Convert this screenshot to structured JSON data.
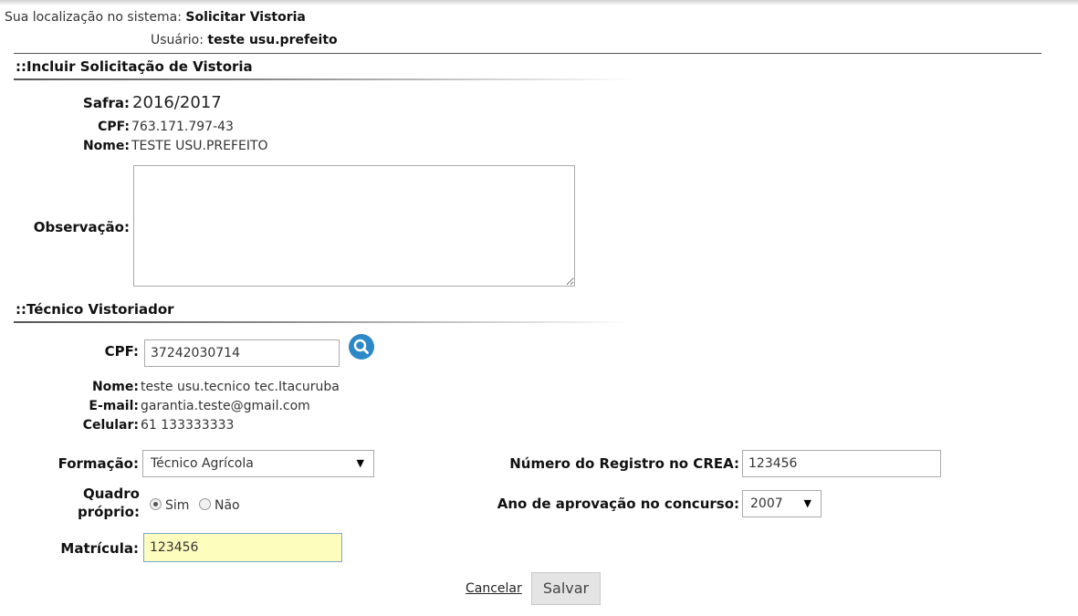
{
  "breadcrumb": {
    "prefix": "Sua localização no sistema:",
    "location": "Solicitar Vistoria"
  },
  "user": {
    "prefix": "Usuário:",
    "name": "teste usu.prefeito"
  },
  "section1": {
    "title": "::Incluir Solicitação de Vistoria",
    "safra_label": "Safra:",
    "safra_value": "2016/2017",
    "cpf_label": "CPF:",
    "cpf_value": "763.171.797-43",
    "nome_label": "Nome:",
    "nome_value": "TESTE USU.PREFEITO",
    "obs_label": "Observação:",
    "obs_value": ""
  },
  "section2": {
    "title": "::Técnico Vistoriador",
    "cpf_label": "CPF:",
    "cpf_value": "37242030714",
    "nome_label": "Nome:",
    "nome_value": "teste usu.tecnico tec.Itacuruba",
    "email_label": "E-mail:",
    "email_value": "garantia.teste@gmail.com",
    "celular_label": "Celular:",
    "celular_value": "61 133333333",
    "formacao_label": "Formação:",
    "formacao_value": "Técnico Agrícola",
    "crea_label": "Número do Registro no CREA:",
    "crea_value": "123456",
    "quadro_label_1": "Quadro",
    "quadro_label_2": "próprio:",
    "quadro_sim": "Sim",
    "quadro_nao": "Não",
    "ano_label": "Ano de aprovação no concurso:",
    "ano_value": "2007",
    "matricula_label": "Matrícula:",
    "matricula_value": "123456"
  },
  "actions": {
    "cancel_label": "Cancelar",
    "save_label": "Salvar"
  },
  "icons": {
    "search": "search-icon",
    "select_arrow": "caret-down-icon",
    "accent": "#2d88c8"
  }
}
